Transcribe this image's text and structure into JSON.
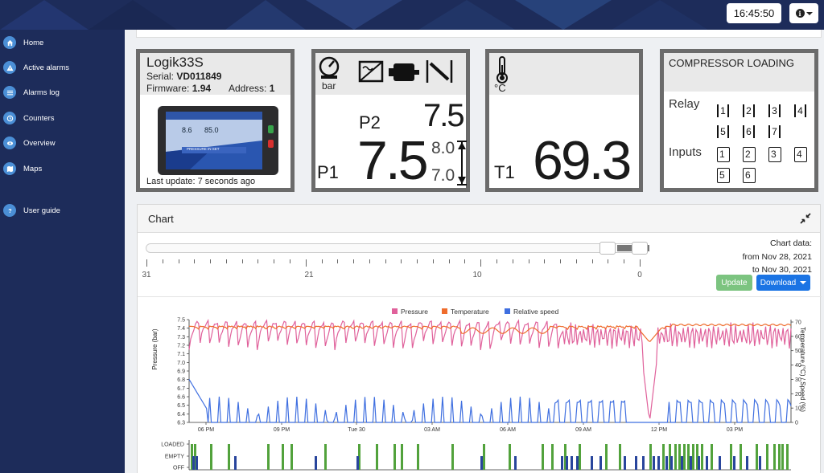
{
  "header": {
    "clock": "16:45:50"
  },
  "sidebar": {
    "items": [
      {
        "label": "Home",
        "icon": "home-icon"
      },
      {
        "label": "Active alarms",
        "icon": "alert-icon"
      },
      {
        "label": "Alarms log",
        "icon": "list-icon"
      },
      {
        "label": "Counters",
        "icon": "counter-icon"
      },
      {
        "label": "Overview",
        "icon": "eye-icon"
      },
      {
        "label": "Maps",
        "icon": "map-icon"
      },
      {
        "label": "User guide",
        "icon": "help-icon"
      }
    ]
  },
  "device_card": {
    "title": "Logik33S",
    "serial_label": "Serial:",
    "serial": "VD011849",
    "firmware_label": "Firmware:",
    "firmware": "1.94",
    "address_label": "Address:",
    "address": "1",
    "last_update": "Last update: 7 seconds ago",
    "screen_value1": "8.6",
    "screen_value2": "85.0",
    "screen_status": "PRESSURE IN SET"
  },
  "pressure_card": {
    "unit": "bar",
    "p2_label": "P2",
    "p2_value": "7.5",
    "p1_label": "P1",
    "p1_value": "7.5",
    "upper": "8.0",
    "lower": "7.0"
  },
  "temp_card": {
    "unit": "°C",
    "t1_label": "T1",
    "t1_value": "69.3"
  },
  "compressor_card": {
    "title": "COMPRESSOR LOADING",
    "relay_label": "Relay",
    "inputs_label": "Inputs",
    "relays": [
      "1",
      "2",
      "3",
      "4",
      "5",
      "6",
      "7"
    ],
    "inputs": [
      "1",
      "2",
      "3",
      "4",
      "5",
      "6"
    ]
  },
  "chart_panel": {
    "title": "Chart",
    "slider_ticks": [
      "31",
      "21",
      "10",
      "0"
    ],
    "info_label": "Chart data:",
    "from_text": "from Nov 28, 2021",
    "to_text": "to Nov 30, 2021",
    "update_label": "Update",
    "download_label": "Download"
  },
  "colors": {
    "sidebar": "#1d2c5a",
    "pressure": "#e0619b",
    "temperature": "#ef6c2c",
    "speed": "#3f6fe0",
    "loaded": "#52a23c",
    "empty": "#28459c",
    "update": "#7cc480",
    "download": "#1b74e4"
  },
  "chart_data": {
    "type": "line",
    "legend": [
      "Pressure",
      "Temperature",
      "Relative speed"
    ],
    "ylabel_left": "Pressure (bar)",
    "ylabel_right": "Temperature (°C) / Speed (%)",
    "y_left_ticks": [
      "7.5",
      "7.4",
      "7.3",
      "7.2",
      "7.1",
      "7.0",
      "6.9",
      "6.8",
      "6.7",
      "6.6",
      "6.5",
      "6.4",
      "6.3"
    ],
    "y_right_ticks": [
      "70",
      "60",
      "50",
      "40",
      "30",
      "20",
      "10",
      "0"
    ],
    "x_ticks": [
      "06 PM",
      "09 PM",
      "Tue 30",
      "03 AM",
      "06 AM",
      "09 AM",
      "12 PM",
      "03 PM"
    ],
    "ylim_left": [
      6.3,
      7.5
    ],
    "ylim_right": [
      0,
      70
    ],
    "state_labels": [
      "LOADED",
      "EMPTY",
      "OFF"
    ],
    "series": [
      {
        "name": "Pressure",
        "approx": "oscillating 7.1–7.5 bar, dip to 6.3 near 10:30 AM"
      },
      {
        "name": "Temperature",
        "approx": "steady 65–70 °C, dip near 10:30 AM"
      },
      {
        "name": "Relative speed",
        "approx": "pulses 0–30 %"
      }
    ]
  }
}
